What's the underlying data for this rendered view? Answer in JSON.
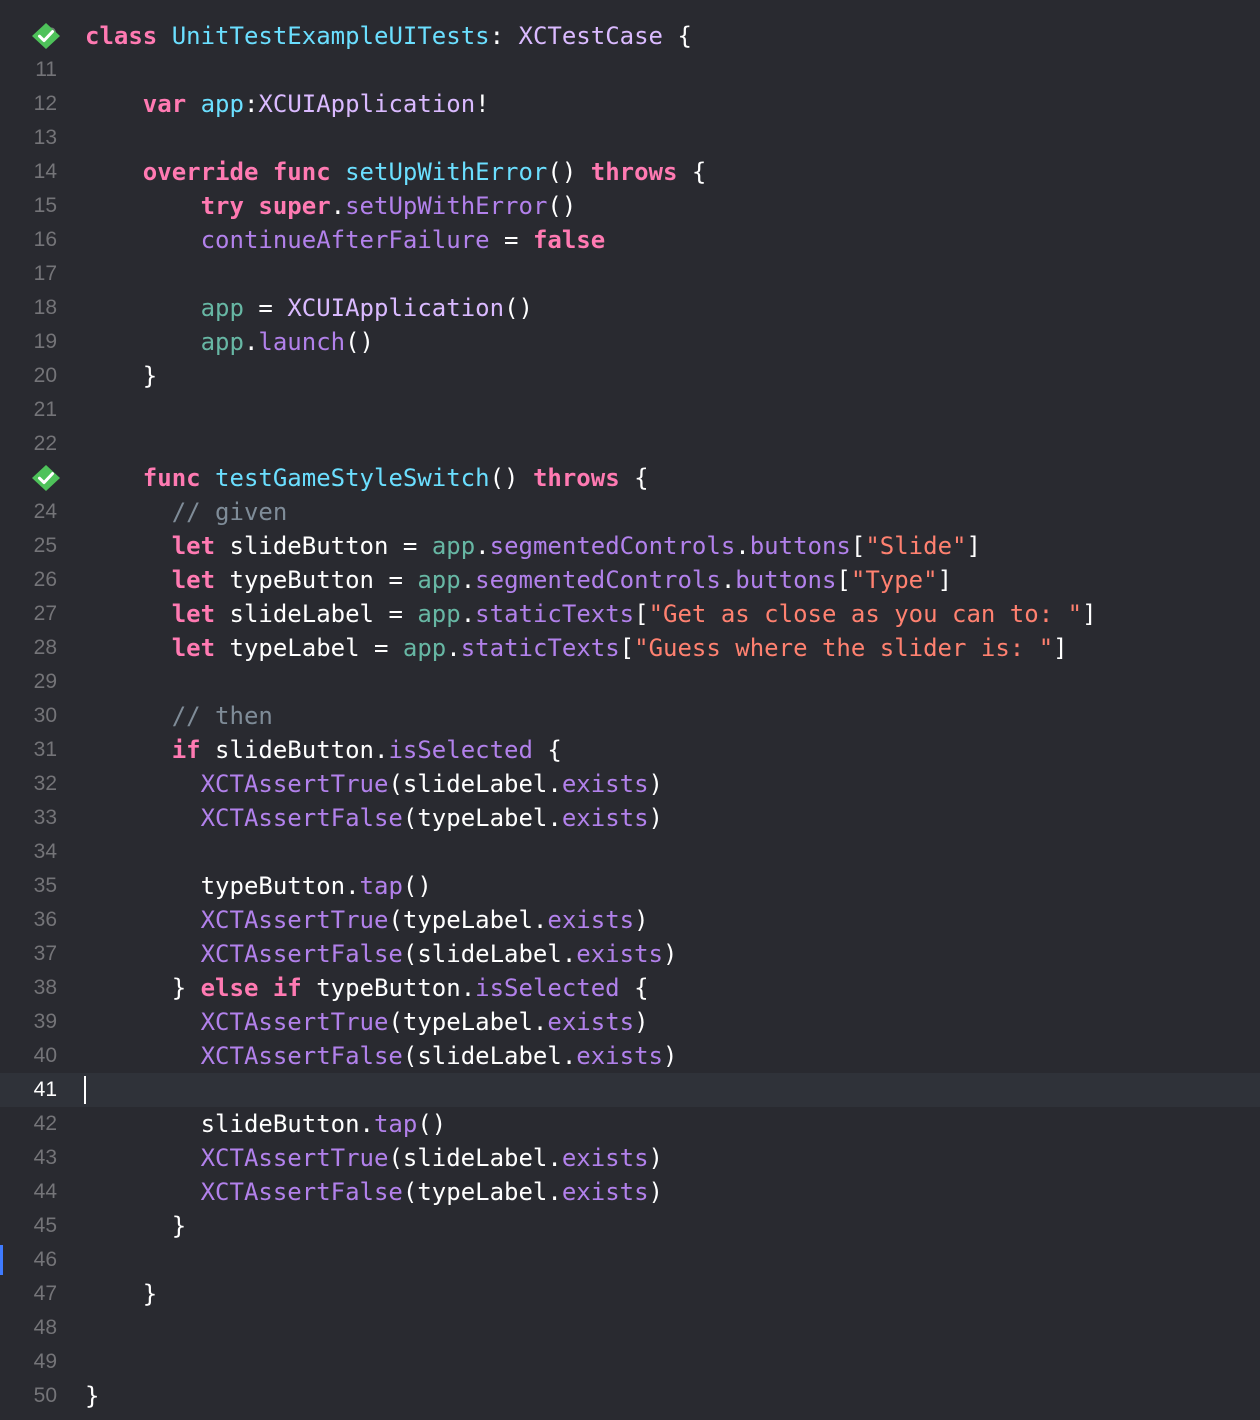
{
  "editor": {
    "first_partial_line_number": "9",
    "current_line": "41",
    "lines": [
      {
        "n": "10",
        "test_passed": true,
        "tokens": [
          {
            "c": "kw",
            "t": "class"
          },
          {
            "c": "pln",
            "t": " "
          },
          {
            "c": "decl",
            "t": "UnitTestExampleUITests"
          },
          {
            "c": "pln",
            "t": ": "
          },
          {
            "c": "type",
            "t": "XCTestCase"
          },
          {
            "c": "pln",
            "t": " {"
          }
        ]
      },
      {
        "n": "11",
        "tokens": []
      },
      {
        "n": "12",
        "tokens": [
          {
            "c": "pln",
            "t": "    "
          },
          {
            "c": "kw",
            "t": "var"
          },
          {
            "c": "pln",
            "t": " "
          },
          {
            "c": "decl",
            "t": "app"
          },
          {
            "c": "pln",
            "t": ":"
          },
          {
            "c": "type",
            "t": "XCUIApplication"
          },
          {
            "c": "pln",
            "t": "!"
          }
        ]
      },
      {
        "n": "13",
        "tokens": []
      },
      {
        "n": "14",
        "tokens": [
          {
            "c": "pln",
            "t": "    "
          },
          {
            "c": "kw",
            "t": "override"
          },
          {
            "c": "pln",
            "t": " "
          },
          {
            "c": "kw",
            "t": "func"
          },
          {
            "c": "pln",
            "t": " "
          },
          {
            "c": "decl",
            "t": "setUpWithError"
          },
          {
            "c": "pln",
            "t": "() "
          },
          {
            "c": "kw",
            "t": "throws"
          },
          {
            "c": "pln",
            "t": " {"
          }
        ]
      },
      {
        "n": "15",
        "tokens": [
          {
            "c": "pln",
            "t": "        "
          },
          {
            "c": "kw",
            "t": "try"
          },
          {
            "c": "pln",
            "t": " "
          },
          {
            "c": "kw",
            "t": "super"
          },
          {
            "c": "pln",
            "t": "."
          },
          {
            "c": "sys",
            "t": "setUpWithError"
          },
          {
            "c": "pln",
            "t": "()"
          }
        ]
      },
      {
        "n": "16",
        "tokens": [
          {
            "c": "pln",
            "t": "        "
          },
          {
            "c": "sys",
            "t": "continueAfterFailure"
          },
          {
            "c": "pln",
            "t": " = "
          },
          {
            "c": "kw",
            "t": "false"
          }
        ]
      },
      {
        "n": "17",
        "tokens": []
      },
      {
        "n": "18",
        "tokens": [
          {
            "c": "pln",
            "t": "        "
          },
          {
            "c": "prop",
            "t": "app"
          },
          {
            "c": "pln",
            "t": " = "
          },
          {
            "c": "type",
            "t": "XCUIApplication"
          },
          {
            "c": "pln",
            "t": "()"
          }
        ]
      },
      {
        "n": "19",
        "tokens": [
          {
            "c": "pln",
            "t": "        "
          },
          {
            "c": "prop",
            "t": "app"
          },
          {
            "c": "pln",
            "t": "."
          },
          {
            "c": "sys",
            "t": "launch"
          },
          {
            "c": "pln",
            "t": "()"
          }
        ]
      },
      {
        "n": "20",
        "tokens": [
          {
            "c": "pln",
            "t": "    }"
          }
        ]
      },
      {
        "n": "21",
        "tokens": []
      },
      {
        "n": "22",
        "tokens": []
      },
      {
        "n": "23",
        "test_passed": true,
        "tokens": [
          {
            "c": "pln",
            "t": "    "
          },
          {
            "c": "kw",
            "t": "func"
          },
          {
            "c": "pln",
            "t": " "
          },
          {
            "c": "decl",
            "t": "testGameStyleSwitch"
          },
          {
            "c": "pln",
            "t": "() "
          },
          {
            "c": "kw",
            "t": "throws"
          },
          {
            "c": "pln",
            "t": " {"
          }
        ]
      },
      {
        "n": "24",
        "tokens": [
          {
            "c": "pln",
            "t": "      "
          },
          {
            "c": "cmt",
            "t": "// given"
          }
        ]
      },
      {
        "n": "25",
        "tokens": [
          {
            "c": "pln",
            "t": "      "
          },
          {
            "c": "kw",
            "t": "let"
          },
          {
            "c": "pln",
            "t": " slideButton = "
          },
          {
            "c": "prop",
            "t": "app"
          },
          {
            "c": "pln",
            "t": "."
          },
          {
            "c": "sys",
            "t": "segmentedControls"
          },
          {
            "c": "pln",
            "t": "."
          },
          {
            "c": "sys",
            "t": "buttons"
          },
          {
            "c": "pln",
            "t": "["
          },
          {
            "c": "str",
            "t": "\"Slide\""
          },
          {
            "c": "pln",
            "t": "]"
          }
        ]
      },
      {
        "n": "26",
        "tokens": [
          {
            "c": "pln",
            "t": "      "
          },
          {
            "c": "kw",
            "t": "let"
          },
          {
            "c": "pln",
            "t": " typeButton = "
          },
          {
            "c": "prop",
            "t": "app"
          },
          {
            "c": "pln",
            "t": "."
          },
          {
            "c": "sys",
            "t": "segmentedControls"
          },
          {
            "c": "pln",
            "t": "."
          },
          {
            "c": "sys",
            "t": "buttons"
          },
          {
            "c": "pln",
            "t": "["
          },
          {
            "c": "str",
            "t": "\"Type\""
          },
          {
            "c": "pln",
            "t": "]"
          }
        ]
      },
      {
        "n": "27",
        "tokens": [
          {
            "c": "pln",
            "t": "      "
          },
          {
            "c": "kw",
            "t": "let"
          },
          {
            "c": "pln",
            "t": " slideLabel = "
          },
          {
            "c": "prop",
            "t": "app"
          },
          {
            "c": "pln",
            "t": "."
          },
          {
            "c": "sys",
            "t": "staticTexts"
          },
          {
            "c": "pln",
            "t": "["
          },
          {
            "c": "str",
            "t": "\"Get as close as you can to: \""
          },
          {
            "c": "pln",
            "t": "]"
          }
        ]
      },
      {
        "n": "28",
        "tokens": [
          {
            "c": "pln",
            "t": "      "
          },
          {
            "c": "kw",
            "t": "let"
          },
          {
            "c": "pln",
            "t": " typeLabel = "
          },
          {
            "c": "prop",
            "t": "app"
          },
          {
            "c": "pln",
            "t": "."
          },
          {
            "c": "sys",
            "t": "staticTexts"
          },
          {
            "c": "pln",
            "t": "["
          },
          {
            "c": "str",
            "t": "\"Guess where the slider is: \""
          },
          {
            "c": "pln",
            "t": "]"
          }
        ]
      },
      {
        "n": "29",
        "tokens": []
      },
      {
        "n": "30",
        "tokens": [
          {
            "c": "pln",
            "t": "      "
          },
          {
            "c": "cmt",
            "t": "// then"
          }
        ]
      },
      {
        "n": "31",
        "tokens": [
          {
            "c": "pln",
            "t": "      "
          },
          {
            "c": "kw",
            "t": "if"
          },
          {
            "c": "pln",
            "t": " slideButton."
          },
          {
            "c": "sys",
            "t": "isSelected"
          },
          {
            "c": "pln",
            "t": " {"
          }
        ]
      },
      {
        "n": "32",
        "tokens": [
          {
            "c": "pln",
            "t": "        "
          },
          {
            "c": "sys",
            "t": "XCTAssertTrue"
          },
          {
            "c": "pln",
            "t": "(slideLabel."
          },
          {
            "c": "sys",
            "t": "exists"
          },
          {
            "c": "pln",
            "t": ")"
          }
        ]
      },
      {
        "n": "33",
        "tokens": [
          {
            "c": "pln",
            "t": "        "
          },
          {
            "c": "sys",
            "t": "XCTAssertFalse"
          },
          {
            "c": "pln",
            "t": "(typeLabel."
          },
          {
            "c": "sys",
            "t": "exists"
          },
          {
            "c": "pln",
            "t": ")"
          }
        ]
      },
      {
        "n": "34",
        "tokens": []
      },
      {
        "n": "35",
        "tokens": [
          {
            "c": "pln",
            "t": "        typeButton."
          },
          {
            "c": "sys",
            "t": "tap"
          },
          {
            "c": "pln",
            "t": "()"
          }
        ]
      },
      {
        "n": "36",
        "tokens": [
          {
            "c": "pln",
            "t": "        "
          },
          {
            "c": "sys",
            "t": "XCTAssertTrue"
          },
          {
            "c": "pln",
            "t": "(typeLabel."
          },
          {
            "c": "sys",
            "t": "exists"
          },
          {
            "c": "pln",
            "t": ")"
          }
        ]
      },
      {
        "n": "37",
        "tokens": [
          {
            "c": "pln",
            "t": "        "
          },
          {
            "c": "sys",
            "t": "XCTAssertFalse"
          },
          {
            "c": "pln",
            "t": "(slideLabel."
          },
          {
            "c": "sys",
            "t": "exists"
          },
          {
            "c": "pln",
            "t": ")"
          }
        ]
      },
      {
        "n": "38",
        "tokens": [
          {
            "c": "pln",
            "t": "      } "
          },
          {
            "c": "kw",
            "t": "else"
          },
          {
            "c": "pln",
            "t": " "
          },
          {
            "c": "kw",
            "t": "if"
          },
          {
            "c": "pln",
            "t": " typeButton."
          },
          {
            "c": "sys",
            "t": "isSelected"
          },
          {
            "c": "pln",
            "t": " {"
          }
        ]
      },
      {
        "n": "39",
        "tokens": [
          {
            "c": "pln",
            "t": "        "
          },
          {
            "c": "sys",
            "t": "XCTAssertTrue"
          },
          {
            "c": "pln",
            "t": "(typeLabel."
          },
          {
            "c": "sys",
            "t": "exists"
          },
          {
            "c": "pln",
            "t": ")"
          }
        ]
      },
      {
        "n": "40",
        "tokens": [
          {
            "c": "pln",
            "t": "        "
          },
          {
            "c": "sys",
            "t": "XCTAssertFalse"
          },
          {
            "c": "pln",
            "t": "(slideLabel."
          },
          {
            "c": "sys",
            "t": "exists"
          },
          {
            "c": "pln",
            "t": ")"
          }
        ]
      },
      {
        "n": "41",
        "current": true,
        "tokens": []
      },
      {
        "n": "42",
        "tokens": [
          {
            "c": "pln",
            "t": "        slideButton."
          },
          {
            "c": "sys",
            "t": "tap"
          },
          {
            "c": "pln",
            "t": "()"
          }
        ]
      },
      {
        "n": "43",
        "tokens": [
          {
            "c": "pln",
            "t": "        "
          },
          {
            "c": "sys",
            "t": "XCTAssertTrue"
          },
          {
            "c": "pln",
            "t": "(slideLabel."
          },
          {
            "c": "sys",
            "t": "exists"
          },
          {
            "c": "pln",
            "t": ")"
          }
        ]
      },
      {
        "n": "44",
        "tokens": [
          {
            "c": "pln",
            "t": "        "
          },
          {
            "c": "sys",
            "t": "XCTAssertFalse"
          },
          {
            "c": "pln",
            "t": "(typeLabel."
          },
          {
            "c": "sys",
            "t": "exists"
          },
          {
            "c": "pln",
            "t": ")"
          }
        ]
      },
      {
        "n": "45",
        "tokens": [
          {
            "c": "pln",
            "t": "      }"
          }
        ]
      },
      {
        "n": "46",
        "changed": true,
        "tokens": []
      },
      {
        "n": "47",
        "tokens": [
          {
            "c": "pln",
            "t": "    }"
          }
        ]
      },
      {
        "n": "48",
        "tokens": []
      },
      {
        "n": "49",
        "tokens": []
      },
      {
        "n": "50",
        "tokens": [
          {
            "c": "pln",
            "t": "}"
          }
        ]
      }
    ]
  }
}
